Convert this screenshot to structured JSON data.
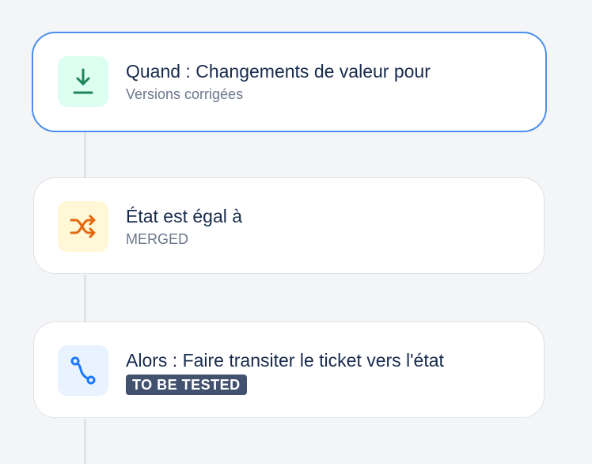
{
  "steps": [
    {
      "title": "Quand : Changements de valeur pour",
      "subtitle": "Versions corrigées",
      "icon": "download-icon",
      "icon_bg": "#dcfff1",
      "icon_color": "#1f845a"
    },
    {
      "title": "État est égal à",
      "subtitle": "MERGED",
      "icon": "shuffle-icon",
      "icon_bg": "#fff7d6",
      "icon_color": "#e56910"
    },
    {
      "title": "Alors : Faire transiter le ticket vers l'état",
      "badge": "TO BE TESTED",
      "icon": "transition-icon",
      "icon_bg": "#e9f2ff",
      "icon_color": "#1d7afc"
    }
  ],
  "colors": {
    "selected_border": "#4c8ef0",
    "background": "#f4f5f7",
    "badge_bg": "#42526e"
  }
}
